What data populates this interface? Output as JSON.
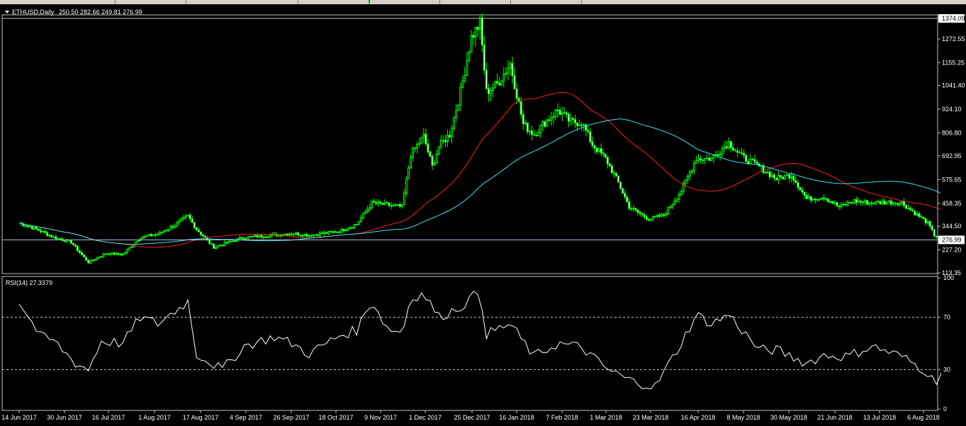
{
  "chart_data": [
    {
      "type": "candlestick",
      "symbol_title": "ETHUSD,Daily",
      "ohlc": "250.50 282.66 249.81 276.99",
      "ylim": [
        113.35,
        1374.09
      ],
      "price_ticks": [
        1374.09,
        1272.55,
        1155.25,
        1041.4,
        924.1,
        806.8,
        692.95,
        575.65,
        458.35,
        344.5,
        227.2,
        113.35
      ],
      "price_tick_labels": [
        "1374.09",
        "1272.55",
        "1155.25",
        "1041.40",
        "924.10",
        "806.80",
        "692.95",
        "575.65",
        "458.35",
        "344.50",
        "227.20",
        "113.35"
      ],
      "current_price": 276.99,
      "current_price_label": "276.99",
      "x_labels": [
        "14 Jun 2017",
        "30 Jun 2017",
        "16 Jul 2017",
        "1 Aug 2017",
        "17 Aug 2017",
        "4 Sep 2017",
        "26 Sep 2017",
        "18 Oct 2017",
        "9 Nov 2017",
        "1 Dec 2017",
        "25 Dec 2017",
        "16 Jan 2018",
        "7 Feb 2018",
        "1 Mar 2018",
        "23 Mar 2018",
        "16 Apr 2018",
        "8 May 2018",
        "30 May 2018",
        "21 Jun 2018",
        "13 Jul 2018",
        "6 Aug 2018"
      ],
      "close_path": [
        [
          "14 Jun 2017",
          360
        ],
        [
          "22 Jun 2017",
          330
        ],
        [
          "30 Jun 2017",
          290
        ],
        [
          "8 Jul 2017",
          265
        ],
        [
          "16 Jul 2017",
          165
        ],
        [
          "24 Jul 2017",
          210
        ],
        [
          "1 Aug 2017",
          205
        ],
        [
          "9 Aug 2017",
          290
        ],
        [
          "17 Aug 2017",
          305
        ],
        [
          "25 Aug 2017",
          350
        ],
        [
          "31 Aug 2017",
          395
        ],
        [
          "4 Sep 2017",
          330
        ],
        [
          "12 Sep 2017",
          240
        ],
        [
          "16 Sep 2017",
          255
        ],
        [
          "26 Sep 2017",
          290
        ],
        [
          "10 Oct 2017",
          300
        ],
        [
          "18 Oct 2017",
          310
        ],
        [
          "26 Oct 2017",
          300
        ],
        [
          "9 Nov 2017",
          320
        ],
        [
          "17 Nov 2017",
          355
        ],
        [
          "24 Nov 2017",
          460
        ],
        [
          "1 Dec 2017",
          450
        ],
        [
          "8 Dec 2017",
          440
        ],
        [
          "12 Dec 2017",
          700
        ],
        [
          "18 Dec 2017",
          790
        ],
        [
          "22 Dec 2017",
          640
        ],
        [
          "25 Dec 2017",
          740
        ],
        [
          "30 Dec 2017",
          800
        ],
        [
          "4 Jan 2018",
          1010
        ],
        [
          "9 Jan 2018",
          1280
        ],
        [
          "13 Jan 2018",
          1350
        ],
        [
          "16 Jan 2018",
          1010
        ],
        [
          "21 Jan 2018",
          1050
        ],
        [
          "27 Jan 2018",
          1150
        ],
        [
          "2 Feb 2018",
          850
        ],
        [
          "7 Feb 2018",
          800
        ],
        [
          "12 Feb 2018",
          860
        ],
        [
          "18 Feb 2018",
          920
        ],
        [
          "24 Feb 2018",
          860
        ],
        [
          "1 Mar 2018",
          860
        ],
        [
          "6 Mar 2018",
          750
        ],
        [
          "12 Mar 2018",
          680
        ],
        [
          "18 Mar 2018",
          560
        ],
        [
          "23 Mar 2018",
          440
        ],
        [
          "1 Apr 2018",
          380
        ],
        [
          "8 Apr 2018",
          400
        ],
        [
          "16 Apr 2018",
          520
        ],
        [
          "23 Apr 2018",
          680
        ],
        [
          "30 Apr 2018",
          680
        ],
        [
          "8 May 2018",
          760
        ],
        [
          "14 May 2018",
          690
        ],
        [
          "22 May 2018",
          640
        ],
        [
          "30 May 2018",
          580
        ],
        [
          "6 Jun 2018",
          600
        ],
        [
          "13 Jun 2018",
          480
        ],
        [
          "21 Jun 2018",
          490
        ],
        [
          "28 Jun 2018",
          440
        ],
        [
          "5 Jul 2018",
          470
        ],
        [
          "13 Jul 2018",
          460
        ],
        [
          "20 Jul 2018",
          465
        ],
        [
          "27 Jul 2018",
          460
        ],
        [
          "2 Aug 2018",
          410
        ],
        [
          "8 Aug 2018",
          360
        ],
        [
          "11 Aug 2018",
          300
        ],
        [
          "14 Aug 2018",
          276.99
        ]
      ],
      "series": [
        {
          "color": "#00ff00"
        },
        {
          "color": "#ff2020"
        },
        {
          "color": "#40e0f0"
        }
      ]
    },
    {
      "type": "line",
      "indicator_label": "RSI(14) 27.3379",
      "ylim": [
        0,
        100
      ],
      "tick_labels": [
        "100",
        "70",
        "30",
        "0"
      ],
      "levels": [
        70,
        30
      ],
      "values": [
        [
          "14 Jun 2017",
          82
        ],
        [
          "24 Jun 2017",
          55
        ],
        [
          "30 Jun 2017",
          52
        ],
        [
          "10 Jul 2017",
          35
        ],
        [
          "16 Jul 2017",
          30
        ],
        [
          "22 Jul 2017",
          52
        ],
        [
          "1 Aug 2017",
          50
        ],
        [
          "9 Aug 2017",
          70
        ],
        [
          "17 Aug 2017",
          65
        ],
        [
          "31 Aug 2017",
          82
        ],
        [
          "4 Sep 2017",
          42
        ],
        [
          "16 Sep 2017",
          30
        ],
        [
          "26 Sep 2017",
          48
        ],
        [
          "10 Oct 2017",
          55
        ],
        [
          "18 Oct 2017",
          50
        ],
        [
          "26 Oct 2017",
          42
        ],
        [
          "9 Nov 2017",
          56
        ],
        [
          "17 Nov 2017",
          60
        ],
        [
          "24 Nov 2017",
          83
        ],
        [
          "1 Dec 2017",
          62
        ],
        [
          "8 Dec 2017",
          58
        ],
        [
          "12 Dec 2017",
          85
        ],
        [
          "18 Dec 2017",
          88
        ],
        [
          "25 Dec 2017",
          70
        ],
        [
          "4 Jan 2018",
          78
        ],
        [
          "13 Jan 2018",
          90
        ],
        [
          "16 Jan 2018",
          57
        ],
        [
          "27 Jan 2018",
          65
        ],
        [
          "7 Feb 2018",
          40
        ],
        [
          "18 Feb 2018",
          50
        ],
        [
          "1 Mar 2018",
          47
        ],
        [
          "12 Mar 2018",
          31
        ],
        [
          "23 Mar 2018",
          22
        ],
        [
          "4 Apr 2018",
          17
        ],
        [
          "16 Apr 2018",
          50
        ],
        [
          "23 Apr 2018",
          72
        ],
        [
          "30 Apr 2018",
          65
        ],
        [
          "8 May 2018",
          72
        ],
        [
          "22 May 2018",
          45
        ],
        [
          "30 May 2018",
          45
        ],
        [
          "13 Jun 2018",
          35
        ],
        [
          "21 Jun 2018",
          41
        ],
        [
          "2 Jul 2018",
          40
        ],
        [
          "13 Jul 2018",
          48
        ],
        [
          "27 Jul 2018",
          40
        ],
        [
          "8 Aug 2018",
          28
        ],
        [
          "11 Aug 2018",
          20
        ],
        [
          "14 Aug 2018",
          27.34
        ]
      ],
      "series": [
        {
          "color": "#ffffff"
        }
      ]
    }
  ]
}
